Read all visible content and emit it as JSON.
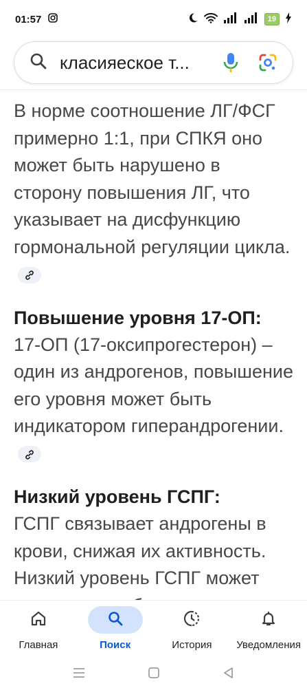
{
  "status": {
    "time": "01:57",
    "battery": "19"
  },
  "search": {
    "query": "класияеское т..."
  },
  "content": {
    "para1": "В норме соотношение ЛГ/ФСГ примерно 1:1, при СПКЯ оно может быть нарушено в сторону повышения ЛГ, что указывает на дисфункцию гормональной регуляции цикла.",
    "heading2": "Повышение уровня 17-ОП:",
    "para2": "17-ОП (17-оксипрогестерон) – один из андрогенов, повышение его уровня может быть индикатором гиперандрогении.",
    "heading3": "Низкий уровень ГСПГ:",
    "para3": "ГСПГ связывает андрогены в крови, снижая их активность. Низкий уровень ГСПГ может указывать на более высокую"
  },
  "nav": {
    "items": [
      {
        "label": "Главная",
        "icon": "home-icon"
      },
      {
        "label": "Поиск",
        "icon": "search-icon"
      },
      {
        "label": "История",
        "icon": "history-icon"
      },
      {
        "label": "Уведомления",
        "icon": "bell-icon"
      }
    ],
    "active_index": 1,
    "accent": "#0b57d0"
  }
}
